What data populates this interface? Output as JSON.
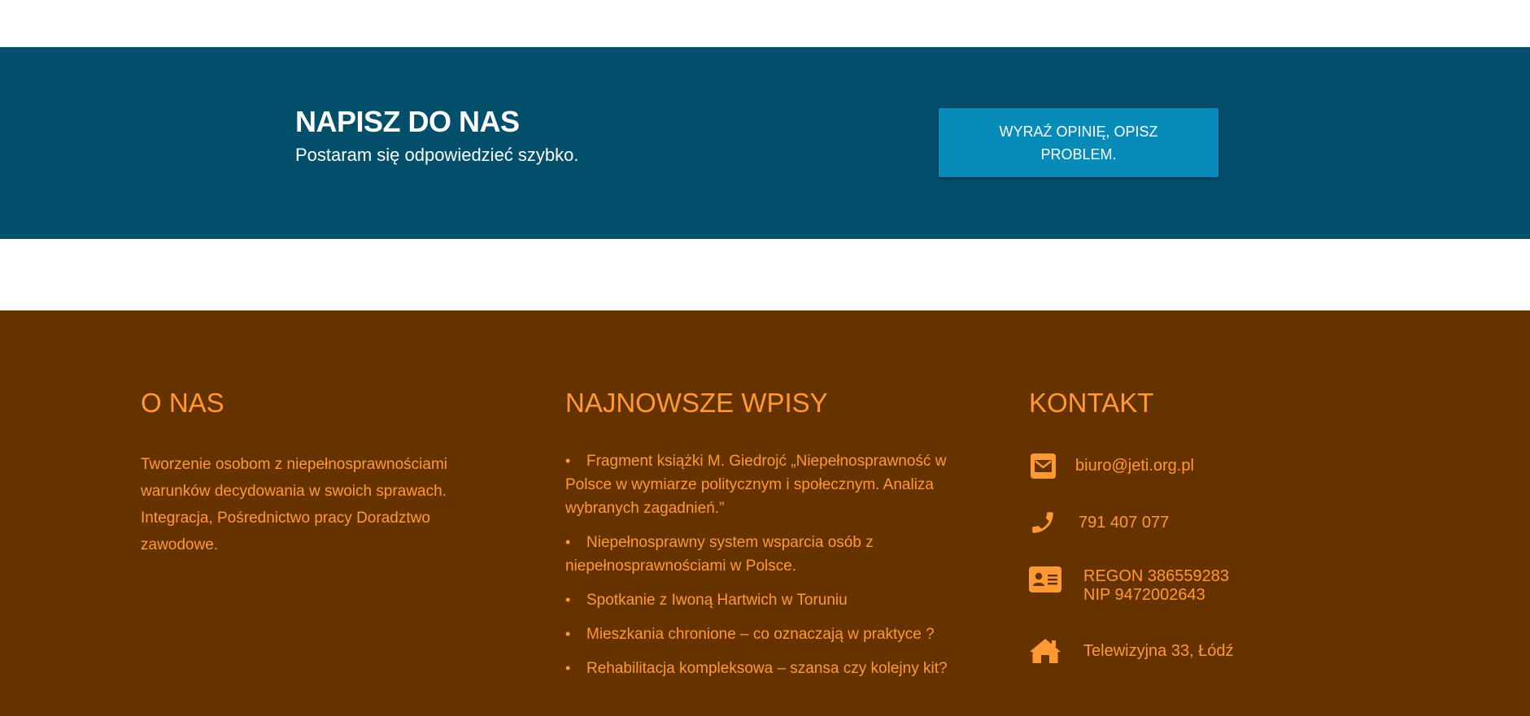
{
  "cta": {
    "title": "NAPISZ DO NAS",
    "subtitle": "Postaram się odpowiedzieć szybko.",
    "button_label": "WYRAŹ OPINIĘ, OPISZ PROBLEM."
  },
  "footer": {
    "about": {
      "title": "O NAS",
      "text": "Tworzenie osobom z niepełnosprawnościami warunków decydowania w swoich sprawach. Integracja, Pośrednictwo pracy Doradztwo zawodowe."
    },
    "posts": {
      "title": "NAJNOWSZE WPISY",
      "items": [
        "Fragment książki M. Giedrojć „Niepełnosprawność w Polsce w wymiarze politycznym i społecznym. Analiza wybranych zagadnień.”",
        "Niepełnosprawny system wsparcia osób z niepełnosprawnościami w Polsce.",
        "Spotkanie z Iwoną Hartwich w Toruniu",
        "Mieszkania chronione – co oznaczają w praktyce ?",
        "Rehabilitacja kompleksowa – szansa czy kolejny kit?"
      ]
    },
    "contact": {
      "title": "KONTAKT",
      "email": "biuro@jeti.org.pl",
      "phone": "791 407 077",
      "regon": "REGON 386559283",
      "nip": "NIP 9472002643",
      "address": "Telewizyjna 33, Łódź",
      "icons": [
        "envelope-icon",
        "phone-icon",
        "id-card-icon",
        "home-icon"
      ]
    }
  },
  "colors": {
    "cta_background": "#024f6b",
    "cta_button": "#088bb9",
    "footer_background": "#663300",
    "footer_text": "#ff9933"
  }
}
